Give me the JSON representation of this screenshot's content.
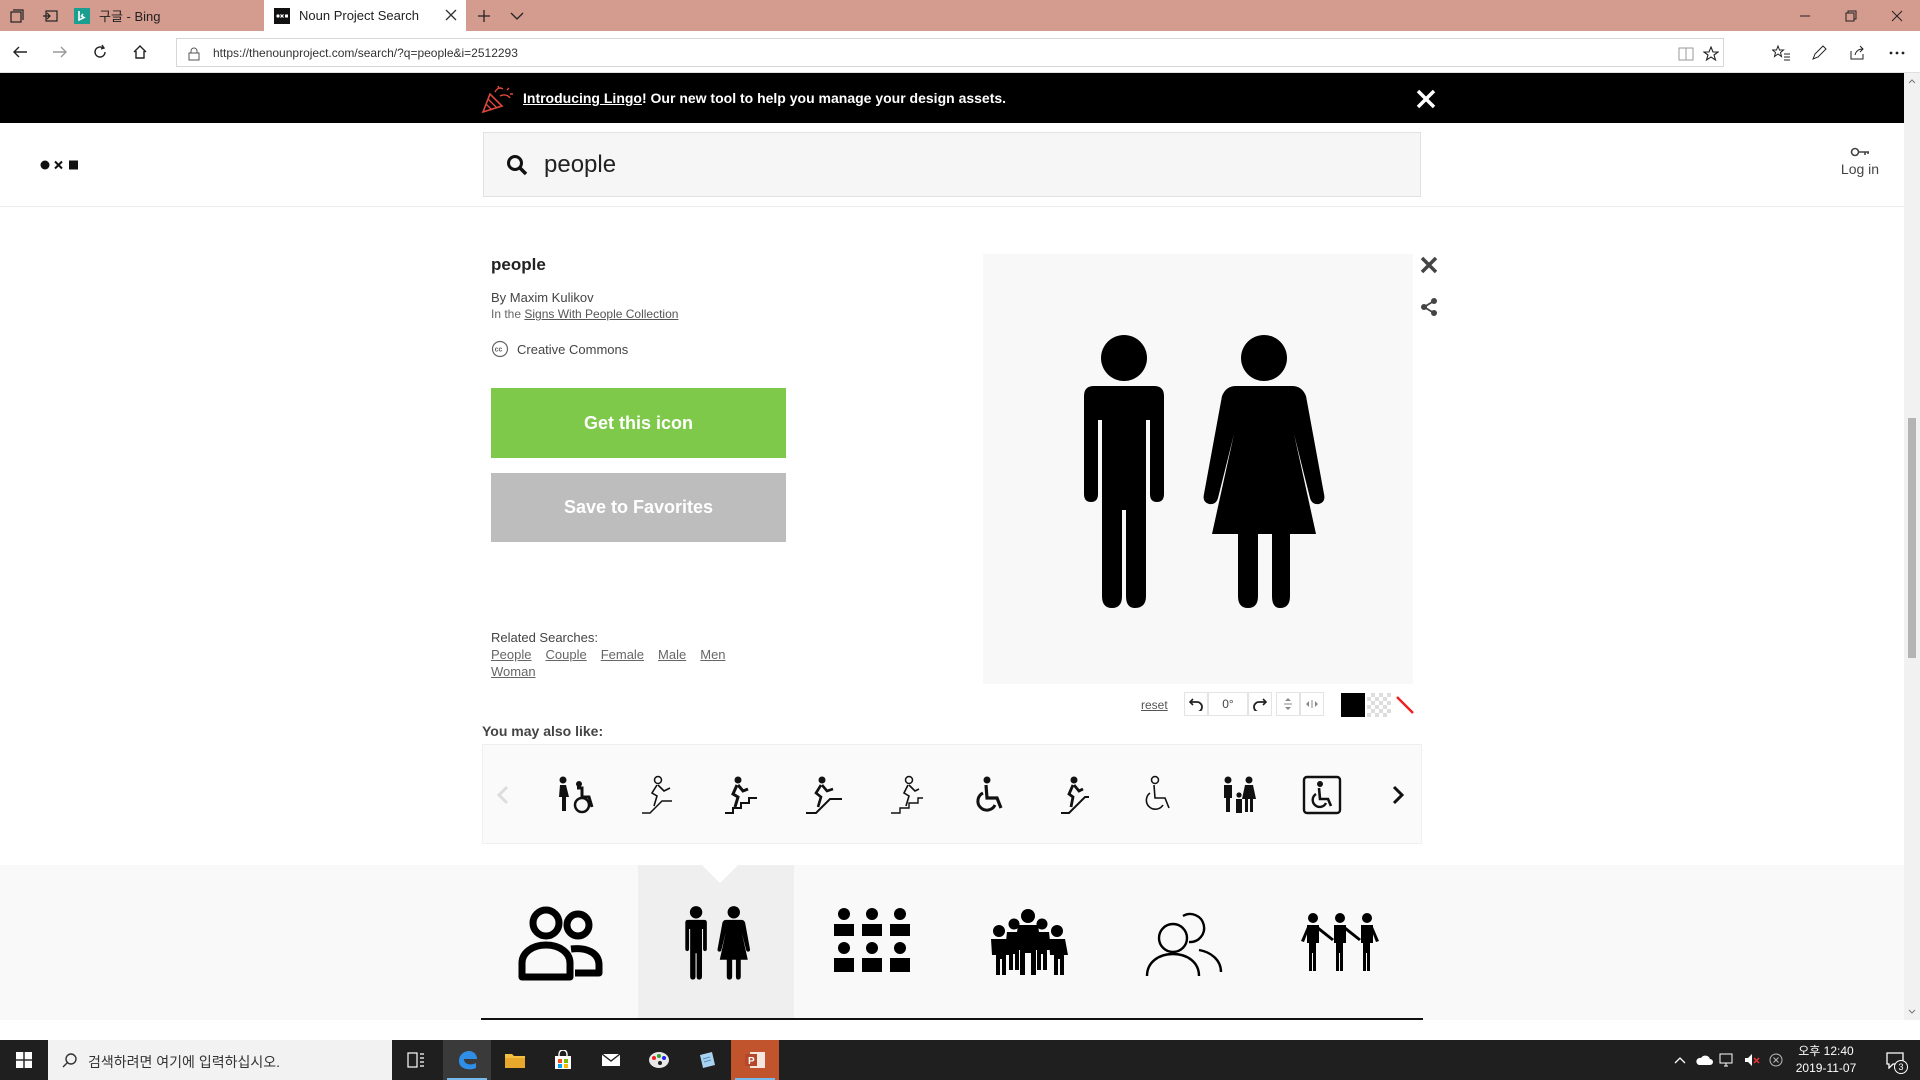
{
  "browser": {
    "tabs": [
      {
        "label": "구글 - Bing",
        "active": false,
        "icon": "bing-icon"
      },
      {
        "label": "Noun Project Search",
        "active": true,
        "icon": "nounproject-favicon"
      }
    ],
    "url": "https://thenounproject.com/search/?q=people&i=2512293"
  },
  "banner": {
    "link": "Introducing Lingo",
    "text": "! Our new tool to help you manage your design assets."
  },
  "header": {
    "search_value": "people",
    "login_label": "Log in"
  },
  "detail": {
    "title": "people",
    "author": "By Maxim Kulikov",
    "collection_prefix": "In the ",
    "collection_link": "Signs With People Collection",
    "license": "Creative Commons",
    "get_button": "Get this icon",
    "favorites_button": "Save to Favorites",
    "related_label": "Related Searches:",
    "related": [
      "People",
      "Couple",
      "Female",
      "Male",
      "Men",
      "Woman"
    ]
  },
  "edit": {
    "reset": "reset",
    "rotation": "0°"
  },
  "also": {
    "label": "You may also like:",
    "icons": [
      "wheelchair-pushing-icon",
      "escalator-person-icon",
      "stairs-person-icon",
      "stairs-up-icon",
      "escalator-down-icon",
      "wheelchair-icon",
      "stairs-climb-icon",
      "wheelchair-outline-icon",
      "family-icon",
      "accessible-sign-icon"
    ]
  },
  "results": [
    "people-group-icon",
    "man-woman-icon",
    "crowd-icon",
    "family-group-icon",
    "users-outline-icon",
    "children-row-icon"
  ],
  "taskbar": {
    "search_placeholder": "검색하려면 여기에 입력하십시오.",
    "time": "오후 12:40",
    "date": "2019-11-07",
    "notifications": "3"
  },
  "colors": {
    "tab_bar": "#d49b8f",
    "get_button": "#7ec84a",
    "favorites_button": "#bdbdbd",
    "banner": "#000000",
    "taskbar": "#1f1f1f"
  }
}
